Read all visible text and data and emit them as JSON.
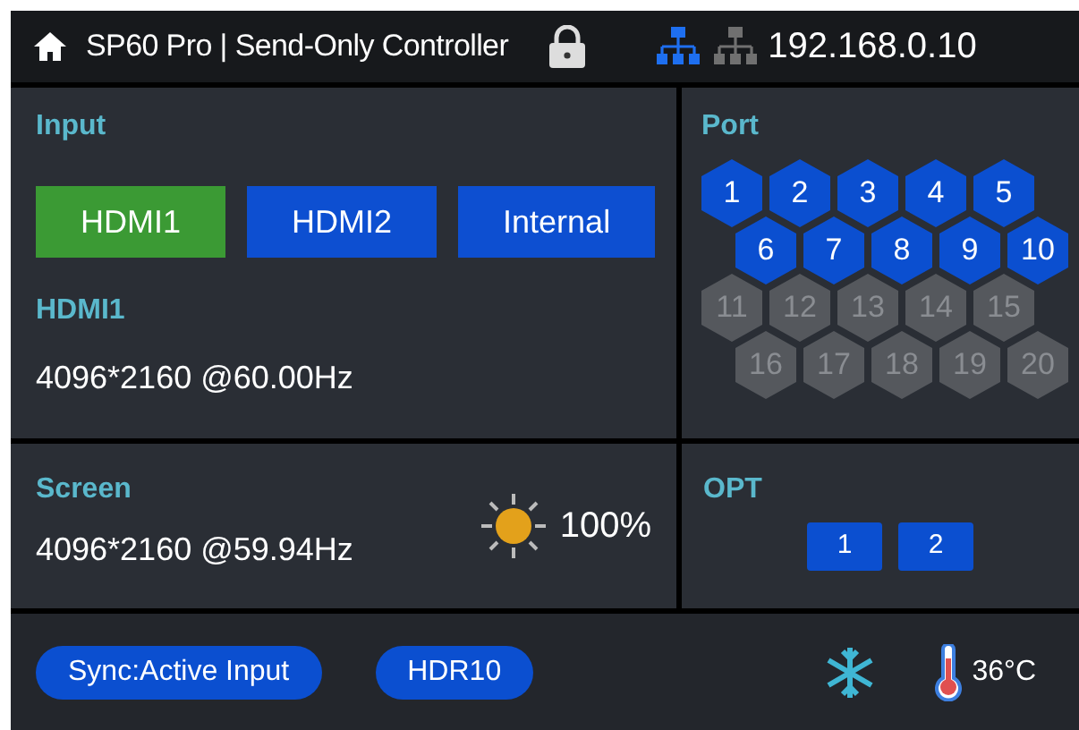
{
  "header": {
    "title": "SP60 Pro | Send-Only Controller",
    "locked": true,
    "network": [
      {
        "active": true
      },
      {
        "active": false
      }
    ],
    "ip": "192.168.0.10"
  },
  "input": {
    "title": "Input",
    "sources": [
      {
        "label": "HDMI1",
        "selected": true
      },
      {
        "label": "HDMI2",
        "selected": false
      },
      {
        "label": "Internal",
        "selected": false
      }
    ],
    "current_label": "HDMI1",
    "current_signal": "4096*2160 @60.00Hz"
  },
  "port": {
    "title": "Port",
    "ports": [
      {
        "label": "1",
        "active": true
      },
      {
        "label": "2",
        "active": true
      },
      {
        "label": "3",
        "active": true
      },
      {
        "label": "4",
        "active": true
      },
      {
        "label": "5",
        "active": true
      },
      {
        "label": "6",
        "active": true
      },
      {
        "label": "7",
        "active": true
      },
      {
        "label": "8",
        "active": true
      },
      {
        "label": "9",
        "active": true
      },
      {
        "label": "10",
        "active": true
      },
      {
        "label": "11",
        "active": false
      },
      {
        "label": "12",
        "active": false
      },
      {
        "label": "13",
        "active": false
      },
      {
        "label": "14",
        "active": false
      },
      {
        "label": "15",
        "active": false
      },
      {
        "label": "16",
        "active": false
      },
      {
        "label": "17",
        "active": false
      },
      {
        "label": "18",
        "active": false
      },
      {
        "label": "19",
        "active": false
      },
      {
        "label": "20",
        "active": false
      }
    ]
  },
  "screen": {
    "title": "Screen",
    "signal": "4096*2160 @59.94Hz",
    "brightness": "100%"
  },
  "opt": {
    "title": "OPT",
    "items": [
      "1",
      "2"
    ]
  },
  "status_bar": {
    "badges": [
      "Sync:Active Input",
      "HDR10"
    ],
    "temperature": "36°C"
  }
}
